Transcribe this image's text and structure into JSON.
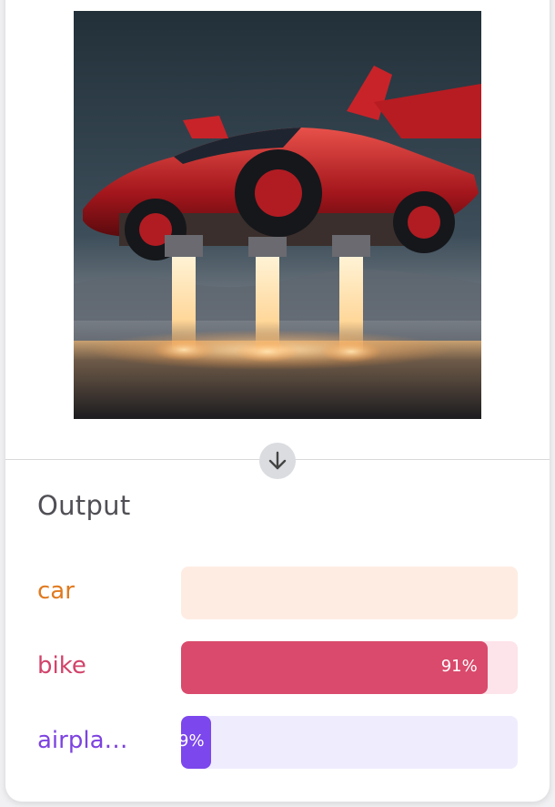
{
  "output": {
    "title": "Output"
  },
  "results": [
    {
      "label": "car",
      "value": 0,
      "percent_text": "",
      "color": "#e07a1f",
      "track_color": "#feece3",
      "fill_color": "#f1a670"
    },
    {
      "label": "bike",
      "value": 0.91,
      "percent_text": "91%",
      "color": "#d2436a",
      "track_color": "#fde4ea",
      "fill_color": "#d94a6c"
    },
    {
      "label": "airpla…",
      "value": 0.09,
      "percent_text": "9%",
      "color": "#7d43e0",
      "track_color": "#efedfd",
      "fill_color": "#7c47ec"
    }
  ],
  "icons": {
    "scroll_down": "arrow-down-icon"
  }
}
